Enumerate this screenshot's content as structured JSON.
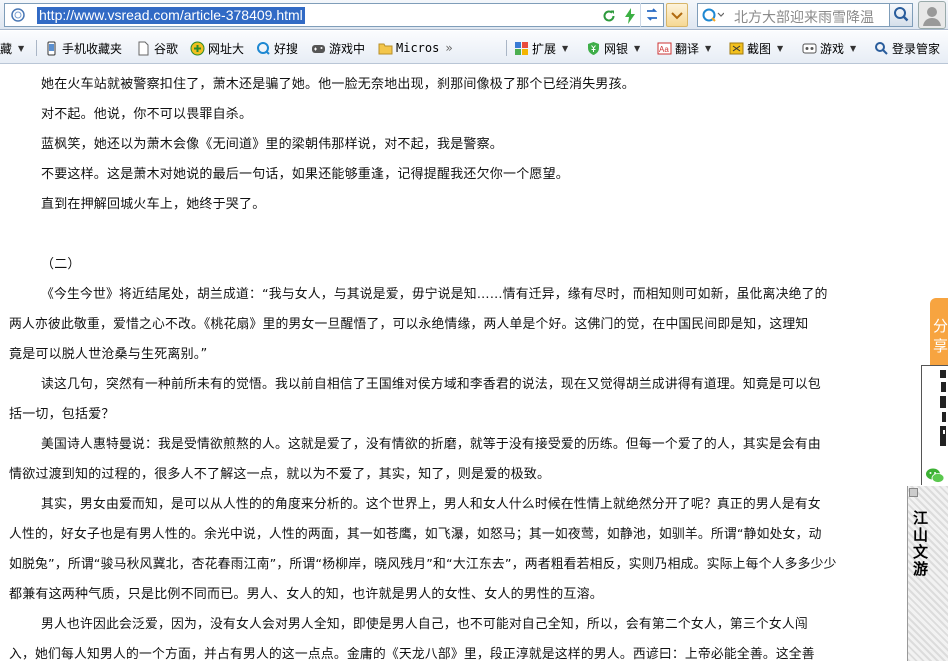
{
  "address_bar": {
    "url": "http://www.vsread.com/article-378409.html",
    "search_placeholder": "北方大部迎来雨雪降温"
  },
  "favorites_bar": {
    "items": [
      {
        "label": "藏",
        "icon": "favorites-star-icon"
      },
      {
        "label": "手机收藏夹",
        "icon": "phone-icon"
      },
      {
        "label": "谷歌",
        "icon": "page-icon"
      },
      {
        "label": "网址大",
        "icon": "plus-circle-icon"
      },
      {
        "label": "好搜",
        "icon": "search-q-icon"
      },
      {
        "label": "游戏中",
        "icon": "gamepad-icon"
      },
      {
        "label": "Micros",
        "icon": "folder-icon"
      },
      {
        "label": "扩展",
        "icon": "extension-grid-icon"
      },
      {
        "label": "网银",
        "icon": "shield-yen-icon"
      },
      {
        "label": "翻译",
        "icon": "translate-icon"
      },
      {
        "label": "截图",
        "icon": "scissors-icon"
      },
      {
        "label": "游戏",
        "icon": "game-icon"
      },
      {
        "label": "登录管家",
        "icon": "login-key-icon"
      }
    ],
    "overflow": "»"
  },
  "article": {
    "lines": [
      "她在火车站就被警察扣住了，萧木还是骗了她。他一脸无奈地出现，刹那间像极了那个已经消失男孩。",
      "对不起。他说，你不可以畏罪自杀。",
      "蓝枫笑，她还以为萧木会像《无间道》里的梁朝伟那样说，对不起，我是警察。",
      "不要这样。这是萧木对她说的最后一句话，如果还能够重逢，记得提醒我还欠你一个愿望。",
      "直到在押解回城火车上，她终于哭了。",
      "（二）",
      "《今生今世》将近结尾处，胡兰成道：“我与女人，与其说是爱，毋宁说是知……情有迁异，缘有尽时，而相知则可如新，虽仳离决绝了的",
      "两人亦彼此敬重，爱惜之心不改。《桃花扇》里的男女一旦醒悟了，可以永绝情缘，两人单是个好。这佛门的觉，在中国民间即是知，这理知",
      "竟是可以脱人世沧桑与生死离别。”",
      "读这几句，突然有一种前所未有的觉悟。我以前自相信了王国维对侯方域和李香君的说法，现在又觉得胡兰成讲得有道理。知竟是可以包",
      "括一切，包括爱？",
      "美国诗人惠特曼说：我是受情欲煎熬的人。这就是爱了，没有情欲的折磨，就等于没有接受爱的历练。但每一个爱了的人，其实是会有由",
      "情欲过渡到知的过程的，很多人不了解这一点，就以为不爱了，其实，知了，则是爱的极致。",
      "其实，男女由爱而知，是可以从人性的的角度来分析的。这个世界上，男人和女人什么时候在性情上就绝然分开了呢？真正的男人是有女",
      "人性的，好女子也是有男人性的。余光中说，人性的两面，其一如苍鹰，如飞瀑，如怒马；其一如夜莺，如静池，如驯羊。所谓“静如处女，动",
      "如脱兔”，所谓“骏马秋风冀北，杏花春雨江南”，所谓“杨柳岸，晓风残月”和“大江东去”，两者粗看若相反，实则乃相成。实际上每个人多多少少",
      "都兼有这两种气质，只是比例不同而已。男人、女人的知，也许就是男人的女性、女人的男性的互溶。",
      "男人也许因此会泛爱，因为，没有女人会对男人全知，即使是男人自己，也不可能对自己全知，所以，会有第二个女人，第三个女人闯",
      "入，她们每人知男人的一个方面，并占有男人的这一点点。金庸的《天龙八部》里，段正淳就是这样的男人。西谚曰：上帝必能全善。这全善"
    ]
  },
  "sidebar": {
    "share_label": "分享",
    "ad_title": "江山文游"
  }
}
